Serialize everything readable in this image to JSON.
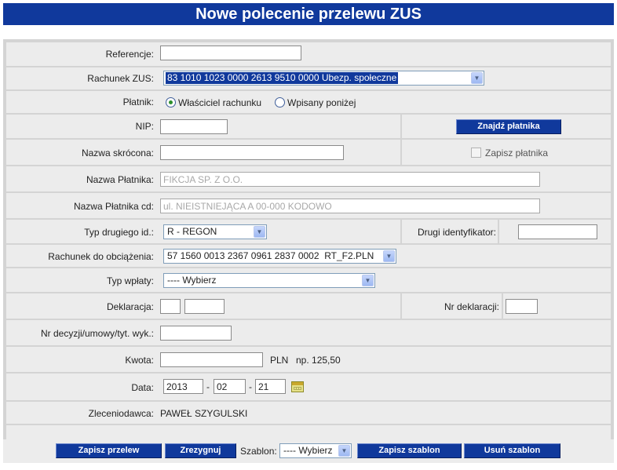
{
  "page_title": "Nowe polecenie przelewu ZUS",
  "fields": {
    "referencje": {
      "label": "Referencje:",
      "value": ""
    },
    "rachunek_zus": {
      "label": "Rachunek ZUS:",
      "value": "83 1010 1023 0000 2613 9510 0000 Ubezp. społeczne"
    },
    "platnik": {
      "label": "Płatnik:",
      "options": [
        "Właściciel rachunku",
        "Wpisany poniżej"
      ],
      "selected": "Właściciel rachunku"
    },
    "nip": {
      "label": "NIP:",
      "value": ""
    },
    "find_payer_button": "Znajdź płatnika",
    "nazwa_skrocona": {
      "label": "Nazwa skrócona:",
      "value": ""
    },
    "save_payer_label": "Zapisz płatnika",
    "nazwa_platnika": {
      "label": "Nazwa Płatnika:",
      "value": "FIKCJA SP. Z O.O."
    },
    "nazwa_platnika_cd": {
      "label": "Nazwa Płatnika cd:",
      "value": "ul. NIEISTNIEJĄCA A 00-000 KODOWO"
    },
    "typ_drugiego_id": {
      "label": "Typ drugiego id.:",
      "value": "R - REGON"
    },
    "drugi_identyfikator": {
      "label": "Drugi identyfikator:",
      "value": ""
    },
    "rachunek_obciazenia": {
      "label": "Rachunek do obciążenia:",
      "value": "57 1560 0013 2367 0961 2837 0002  RT_F2.PLN"
    },
    "typ_wplaty": {
      "label": "Typ wpłaty:",
      "value": "---- Wybierz"
    },
    "deklaracja": {
      "label": "Deklaracja:",
      "value1": "",
      "value2": ""
    },
    "nr_deklaracji": {
      "label": "Nr deklaracji:",
      "value": ""
    },
    "nr_decyzji": {
      "label": "Nr decyzji/umowy/tyt. wyk.:",
      "value": ""
    },
    "kwota": {
      "label": "Kwota:",
      "value": "",
      "currency": "PLN",
      "hint": "np. 125,50"
    },
    "data": {
      "label": "Data:",
      "year": "2013",
      "month": "02",
      "day": "21",
      "sep": "-"
    },
    "zleceniodawca": {
      "label": "Zleceniodawca:",
      "value": "PAWEŁ SZYGULSKI"
    }
  },
  "footer": {
    "save_transfer": "Zapisz przelew",
    "cancel": "Zrezygnuj",
    "template_label": "Szablon:",
    "template_value": "---- Wybierz",
    "save_template": "Zapisz szablon",
    "delete_template": "Usuń szablon"
  },
  "colors": {
    "header_bg": "#10399c",
    "row_bg": "#ececec",
    "frame_bg": "#d4d4d4",
    "button_bg": "#10399c"
  },
  "icons": {
    "dropdown": "chevron-down-icon",
    "calendar": "calendar-icon",
    "radio_selected": "radio-checked-icon"
  }
}
